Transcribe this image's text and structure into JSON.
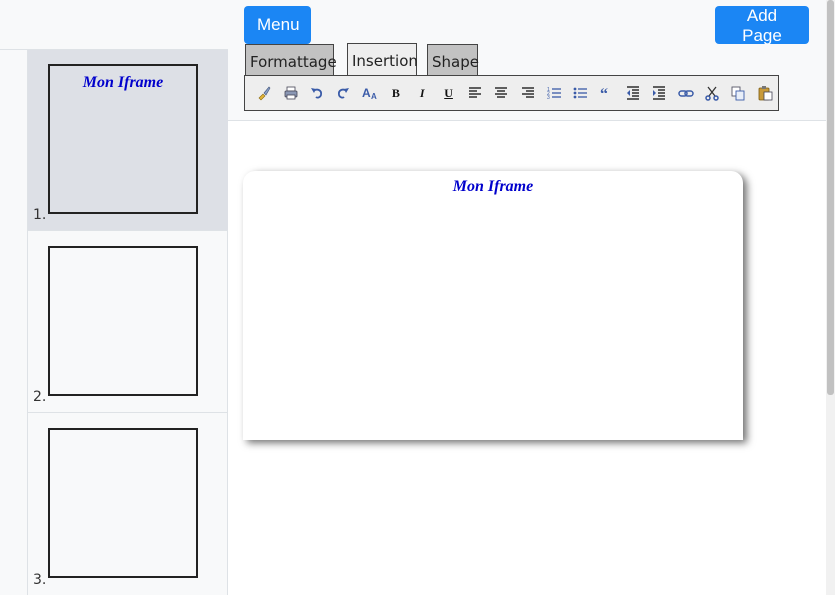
{
  "header": {
    "menu_label": "Menu",
    "add_page_label": "Add Page"
  },
  "tabs": [
    {
      "label": "Formattage"
    },
    {
      "label": "Insertion"
    },
    {
      "label": "Shape"
    }
  ],
  "toolbar": {
    "icons": [
      "brush-icon",
      "print-icon",
      "undo-icon",
      "redo-icon",
      "font-size-icon",
      "bold-icon",
      "italic-icon",
      "underline-icon",
      "align-left-icon",
      "align-center-icon",
      "align-right-icon",
      "ordered-list-icon",
      "unordered-list-icon",
      "blockquote-icon",
      "outdent-icon",
      "indent-icon",
      "link-icon",
      "cut-icon",
      "copy-icon",
      "paste-icon"
    ],
    "bold": "B",
    "italic": "I",
    "underline": "U"
  },
  "pages": [
    {
      "number": "1.",
      "title": "Mon Iframe",
      "active": true
    },
    {
      "number": "2.",
      "title": "",
      "active": false
    },
    {
      "number": "3.",
      "title": "",
      "active": false
    }
  ],
  "editor": {
    "page_title": "Mon Iframe"
  },
  "colors": {
    "primary": "#1b86f4",
    "title_text": "#0000cc"
  }
}
